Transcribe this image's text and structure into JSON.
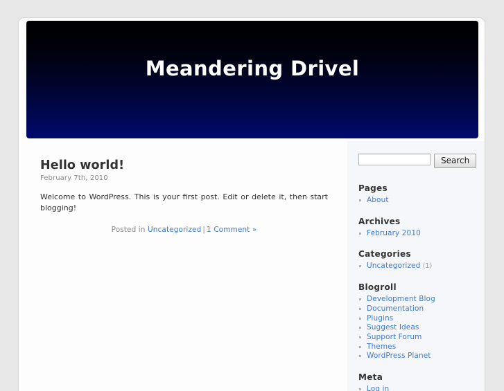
{
  "site": {
    "title": "Meandering Drivel"
  },
  "post": {
    "title": "Hello world!",
    "date": "February 7th, 2010",
    "body": "Welcome to WordPress. This is your first post. Edit or delete it, then start blogging!",
    "meta": {
      "posted_in_label": "Posted in",
      "category": "Uncategorized",
      "separator": "|",
      "comments": "1 Comment »"
    }
  },
  "sidebar": {
    "search": {
      "value": "",
      "placeholder": "",
      "button_label": "Search"
    },
    "widgets": [
      {
        "title": "Pages",
        "items": [
          {
            "label": "About",
            "count": ""
          }
        ]
      },
      {
        "title": "Archives",
        "items": [
          {
            "label": "February 2010",
            "count": ""
          }
        ]
      },
      {
        "title": "Categories",
        "items": [
          {
            "label": "Uncategorized",
            "count": "(1)"
          }
        ]
      },
      {
        "title": "Blogroll",
        "items": [
          {
            "label": "Development Blog",
            "count": ""
          },
          {
            "label": "Documentation",
            "count": ""
          },
          {
            "label": "Plugins",
            "count": ""
          },
          {
            "label": "Suggest Ideas",
            "count": ""
          },
          {
            "label": "Support Forum",
            "count": ""
          },
          {
            "label": "Themes",
            "count": ""
          },
          {
            "label": "WordPress Planet",
            "count": ""
          }
        ]
      },
      {
        "title": "Meta",
        "items": [
          {
            "label": "Log in",
            "count": ""
          }
        ]
      }
    ]
  },
  "colors": {
    "page_background": "#e7e7e7",
    "container_background": "#fdfdfd",
    "sidebar_background": "#f5f7fa",
    "header_gradient_top": "#000003",
    "header_gradient_bottom": "#000a6e",
    "link": "#3b7ad6",
    "text": "#333333",
    "muted_text": "#888888"
  }
}
